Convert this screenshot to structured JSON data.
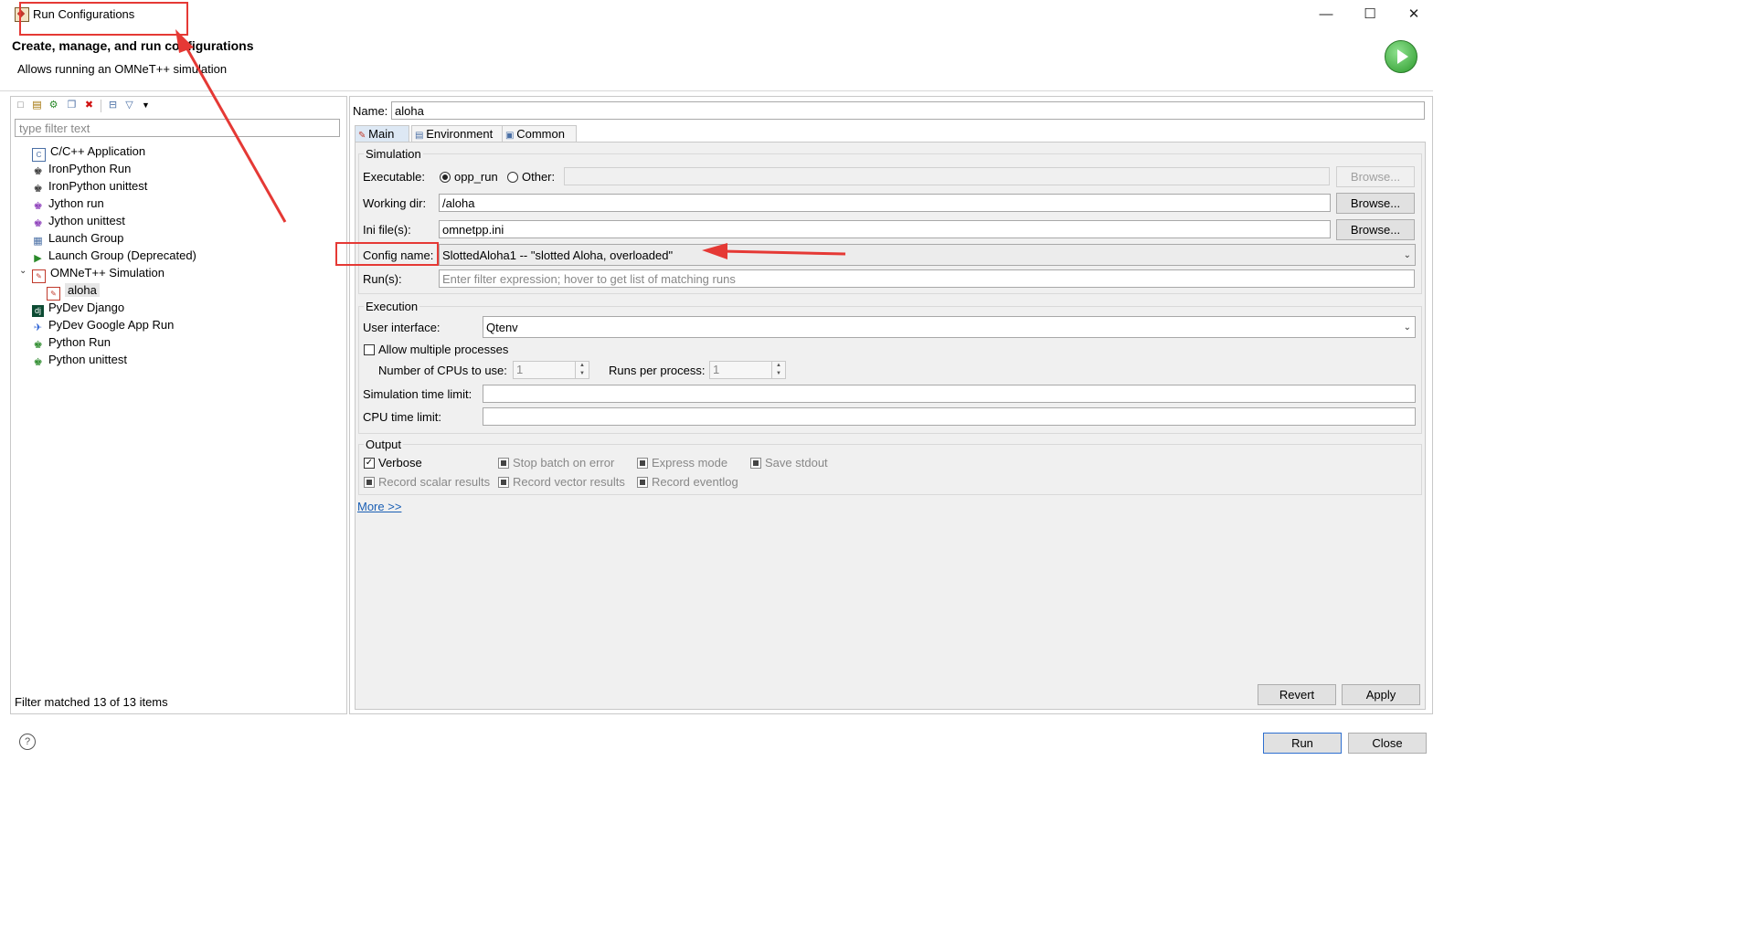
{
  "window": {
    "title": "Run Configurations",
    "minimize_glyph": "—",
    "maximize_glyph": "☐",
    "close_glyph": "✕"
  },
  "header": {
    "title": "Create, manage, and run configurations",
    "description": "Allows running an OMNeT++ simulation"
  },
  "left": {
    "filter_placeholder": "type filter text",
    "tree": [
      {
        "label": "C/C++ Application",
        "icon": "c-application-icon"
      },
      {
        "label": "IronPython Run",
        "icon": "ironpython-icon"
      },
      {
        "label": "IronPython unittest",
        "icon": "ironpython-unittest-icon"
      },
      {
        "label": "Jython run",
        "icon": "jython-icon"
      },
      {
        "label": "Jython unittest",
        "icon": "jython-unittest-icon"
      },
      {
        "label": "Launch Group",
        "icon": "launch-group-icon"
      },
      {
        "label": "Launch Group (Deprecated)",
        "icon": "launch-group-deprecated-icon"
      },
      {
        "label": "OMNeT++ Simulation",
        "icon": "omnetpp-icon"
      },
      {
        "label": "aloha",
        "icon": "config-icon"
      },
      {
        "label": "PyDev Django",
        "icon": "django-icon"
      },
      {
        "label": "PyDev Google App Run",
        "icon": "google-app-icon"
      },
      {
        "label": "Python Run",
        "icon": "python-icon"
      },
      {
        "label": "Python unittest",
        "icon": "python-unittest-icon"
      }
    ],
    "status": "Filter matched 13 of 13 items"
  },
  "right": {
    "name_label": "Name:",
    "name_value": "aloha",
    "tabs": [
      "Main",
      "Environment",
      "Common"
    ],
    "simulation": {
      "group": "Simulation",
      "executable_label": "Executable:",
      "opt_opp_run": "opp_run",
      "opt_other": "Other:",
      "working_dir_label": "Working dir:",
      "working_dir_value": "/aloha",
      "ini_label": "Ini file(s):",
      "ini_value": "omnetpp.ini",
      "config_label": "Config name:",
      "config_value": "SlottedAloha1 -- \"slotted Aloha, overloaded\"",
      "runs_label": "Run(s):",
      "runs_placeholder": "Enter filter expression; hover to get list of matching runs",
      "browse": "Browse..."
    },
    "execution": {
      "group": "Execution",
      "ui_label": "User interface:",
      "ui_value": "Qtenv",
      "allow_multi": "Allow multiple processes",
      "cpus_label": "Number of CPUs to use:",
      "cpus_value": "1",
      "runs_per_label": "Runs per process:",
      "runs_per_value": "1",
      "sim_time_label": "Simulation time limit:",
      "cpu_time_label": "CPU time limit:"
    },
    "output": {
      "group": "Output",
      "verbose": "Verbose",
      "stop_batch": "Stop batch on error",
      "express": "Express mode",
      "save_stdout": "Save stdout",
      "record_scalar": "Record scalar results",
      "record_vector": "Record vector results",
      "record_eventlog": "Record eventlog"
    },
    "more": "More >>",
    "revert": "Revert",
    "apply": "Apply"
  },
  "footer": {
    "help": "?",
    "run": "Run",
    "close": "Close"
  },
  "colors": {
    "annotation_red": "#e53935",
    "link_blue": "#1a5fb4"
  }
}
